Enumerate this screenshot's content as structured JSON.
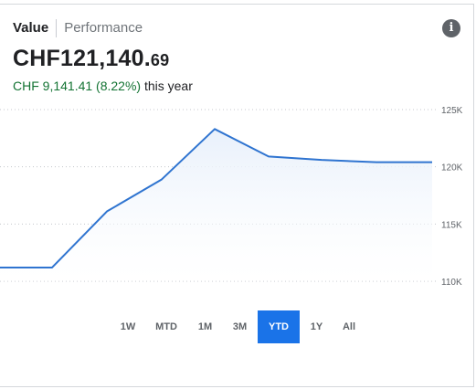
{
  "tabs": {
    "value": "Value",
    "performance": "Performance"
  },
  "info_icon": "info-icon",
  "amount": {
    "main": "CHF121,140.",
    "cents": "69"
  },
  "change": {
    "gain": "CHF 9,141.41 (8.22%)",
    "period": "this year"
  },
  "ranges": [
    "1W",
    "MTD",
    "1M",
    "3M",
    "YTD",
    "1Y",
    "All"
  ],
  "active_range": "YTD",
  "colors": {
    "line": "#2f74d0",
    "fill": "#e8f0fb",
    "gain": "#137333",
    "active": "#1a73e8"
  },
  "chart_data": {
    "type": "area",
    "y_ticks": [
      {
        "label": "125K",
        "value": 125000
      },
      {
        "label": "120K",
        "value": 120000
      },
      {
        "label": "115K",
        "value": 115000
      },
      {
        "label": "110K",
        "value": 110000
      }
    ],
    "ylim": [
      110000,
      125000
    ],
    "x": [
      0,
      1,
      2,
      3,
      4,
      5,
      6,
      7,
      8
    ],
    "values": [
      111200,
      111200,
      116100,
      118900,
      123300,
      120900,
      120600,
      120400,
      120400
    ],
    "grid": "dotted-horizontal"
  }
}
